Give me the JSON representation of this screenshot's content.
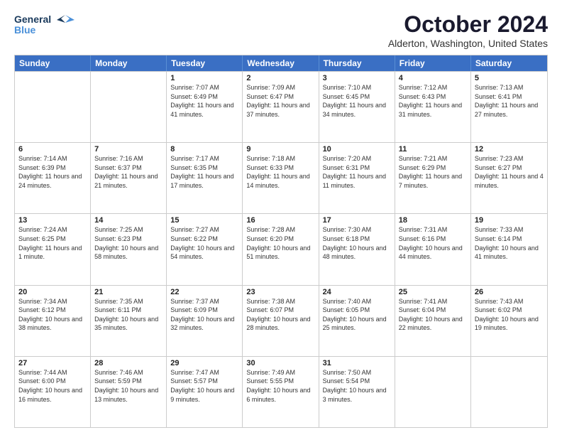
{
  "header": {
    "logo_line1": "General",
    "logo_line2": "Blue",
    "title": "October 2024",
    "subtitle": "Alderton, Washington, United States"
  },
  "weekdays": [
    "Sunday",
    "Monday",
    "Tuesday",
    "Wednesday",
    "Thursday",
    "Friday",
    "Saturday"
  ],
  "weeks": [
    [
      {
        "day": "",
        "info": ""
      },
      {
        "day": "",
        "info": ""
      },
      {
        "day": "1",
        "info": "Sunrise: 7:07 AM\nSunset: 6:49 PM\nDaylight: 11 hours and 41 minutes."
      },
      {
        "day": "2",
        "info": "Sunrise: 7:09 AM\nSunset: 6:47 PM\nDaylight: 11 hours and 37 minutes."
      },
      {
        "day": "3",
        "info": "Sunrise: 7:10 AM\nSunset: 6:45 PM\nDaylight: 11 hours and 34 minutes."
      },
      {
        "day": "4",
        "info": "Sunrise: 7:12 AM\nSunset: 6:43 PM\nDaylight: 11 hours and 31 minutes."
      },
      {
        "day": "5",
        "info": "Sunrise: 7:13 AM\nSunset: 6:41 PM\nDaylight: 11 hours and 27 minutes."
      }
    ],
    [
      {
        "day": "6",
        "info": "Sunrise: 7:14 AM\nSunset: 6:39 PM\nDaylight: 11 hours and 24 minutes."
      },
      {
        "day": "7",
        "info": "Sunrise: 7:16 AM\nSunset: 6:37 PM\nDaylight: 11 hours and 21 minutes."
      },
      {
        "day": "8",
        "info": "Sunrise: 7:17 AM\nSunset: 6:35 PM\nDaylight: 11 hours and 17 minutes."
      },
      {
        "day": "9",
        "info": "Sunrise: 7:18 AM\nSunset: 6:33 PM\nDaylight: 11 hours and 14 minutes."
      },
      {
        "day": "10",
        "info": "Sunrise: 7:20 AM\nSunset: 6:31 PM\nDaylight: 11 hours and 11 minutes."
      },
      {
        "day": "11",
        "info": "Sunrise: 7:21 AM\nSunset: 6:29 PM\nDaylight: 11 hours and 7 minutes."
      },
      {
        "day": "12",
        "info": "Sunrise: 7:23 AM\nSunset: 6:27 PM\nDaylight: 11 hours and 4 minutes."
      }
    ],
    [
      {
        "day": "13",
        "info": "Sunrise: 7:24 AM\nSunset: 6:25 PM\nDaylight: 11 hours and 1 minute."
      },
      {
        "day": "14",
        "info": "Sunrise: 7:25 AM\nSunset: 6:23 PM\nDaylight: 10 hours and 58 minutes."
      },
      {
        "day": "15",
        "info": "Sunrise: 7:27 AM\nSunset: 6:22 PM\nDaylight: 10 hours and 54 minutes."
      },
      {
        "day": "16",
        "info": "Sunrise: 7:28 AM\nSunset: 6:20 PM\nDaylight: 10 hours and 51 minutes."
      },
      {
        "day": "17",
        "info": "Sunrise: 7:30 AM\nSunset: 6:18 PM\nDaylight: 10 hours and 48 minutes."
      },
      {
        "day": "18",
        "info": "Sunrise: 7:31 AM\nSunset: 6:16 PM\nDaylight: 10 hours and 44 minutes."
      },
      {
        "day": "19",
        "info": "Sunrise: 7:33 AM\nSunset: 6:14 PM\nDaylight: 10 hours and 41 minutes."
      }
    ],
    [
      {
        "day": "20",
        "info": "Sunrise: 7:34 AM\nSunset: 6:12 PM\nDaylight: 10 hours and 38 minutes."
      },
      {
        "day": "21",
        "info": "Sunrise: 7:35 AM\nSunset: 6:11 PM\nDaylight: 10 hours and 35 minutes."
      },
      {
        "day": "22",
        "info": "Sunrise: 7:37 AM\nSunset: 6:09 PM\nDaylight: 10 hours and 32 minutes."
      },
      {
        "day": "23",
        "info": "Sunrise: 7:38 AM\nSunset: 6:07 PM\nDaylight: 10 hours and 28 minutes."
      },
      {
        "day": "24",
        "info": "Sunrise: 7:40 AM\nSunset: 6:05 PM\nDaylight: 10 hours and 25 minutes."
      },
      {
        "day": "25",
        "info": "Sunrise: 7:41 AM\nSunset: 6:04 PM\nDaylight: 10 hours and 22 minutes."
      },
      {
        "day": "26",
        "info": "Sunrise: 7:43 AM\nSunset: 6:02 PM\nDaylight: 10 hours and 19 minutes."
      }
    ],
    [
      {
        "day": "27",
        "info": "Sunrise: 7:44 AM\nSunset: 6:00 PM\nDaylight: 10 hours and 16 minutes."
      },
      {
        "day": "28",
        "info": "Sunrise: 7:46 AM\nSunset: 5:59 PM\nDaylight: 10 hours and 13 minutes."
      },
      {
        "day": "29",
        "info": "Sunrise: 7:47 AM\nSunset: 5:57 PM\nDaylight: 10 hours and 9 minutes."
      },
      {
        "day": "30",
        "info": "Sunrise: 7:49 AM\nSunset: 5:55 PM\nDaylight: 10 hours and 6 minutes."
      },
      {
        "day": "31",
        "info": "Sunrise: 7:50 AM\nSunset: 5:54 PM\nDaylight: 10 hours and 3 minutes."
      },
      {
        "day": "",
        "info": ""
      },
      {
        "day": "",
        "info": ""
      }
    ]
  ]
}
